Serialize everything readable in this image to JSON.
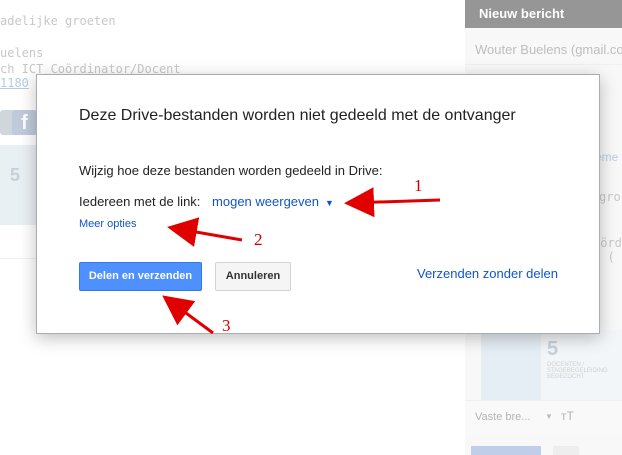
{
  "background": {
    "signature_lines": [
      "adelijke groeten",
      "",
      "uelens",
      "ch ICT Coördinator/Docent",
      "1180"
    ],
    "banner_number": "5"
  },
  "compose": {
    "title": "Nieuw bericht",
    "to": "Wouter Buelens (gmail.co",
    "body_lines": [
      "gro",
      "oörd",
      "- ("
    ],
    "meme_text": "eme",
    "banner_number": "5",
    "banner_text": "DOCENTEN / STAGEBEGELEIDING BEGEZOCHT",
    "font_select": "Vaste bre...",
    "size_icon": "тT"
  },
  "dialog": {
    "title": "Deze Drive-bestanden worden niet gedeeld met de ontvanger",
    "instruction": "Wijzig hoe deze bestanden worden gedeeld in Drive:",
    "link_label": "Iedereen met de link:",
    "permission": "mogen weergeven",
    "more_options": "Meer opties",
    "share_send_label": "Delen en verzenden",
    "cancel_label": "Annuleren",
    "send_without_sharing": "Verzenden zonder delen"
  },
  "annotations": {
    "one": "1",
    "two": "2",
    "three": "3",
    "arrow_color": "#e00000"
  },
  "colors": {
    "primary_button": "#4d90fe",
    "link": "#1155cc",
    "compose_header": "#404040"
  }
}
